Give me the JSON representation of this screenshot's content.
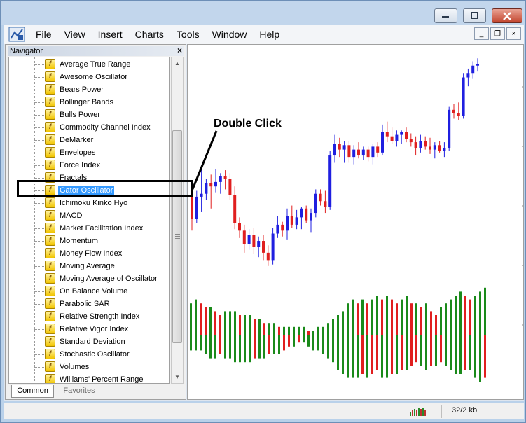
{
  "window": {
    "minimize_icon": "minimize-icon",
    "restore_icon": "restore-icon",
    "close_icon": "close-icon"
  },
  "menu": {
    "items": [
      "File",
      "View",
      "Insert",
      "Charts",
      "Tools",
      "Window",
      "Help"
    ]
  },
  "mdi": {
    "minimize": "_",
    "restore": "❐",
    "close": "×"
  },
  "navigator": {
    "title": "Navigator",
    "close": "×",
    "indicator_icon": "f",
    "items": [
      "Average True Range",
      "Awesome Oscillator",
      "Bears Power",
      "Bollinger Bands",
      "Bulls Power",
      "Commodity Channel Index",
      "DeMarker",
      "Envelopes",
      "Force Index",
      "Fractals",
      "Gator Oscillator",
      "Ichimoku Kinko Hyo",
      "MACD",
      "Market Facilitation Index",
      "Momentum",
      "Money Flow Index",
      "Moving Average",
      "Moving Average of Oscillator",
      "On Balance Volume",
      "Parabolic SAR",
      "Relative Strength Index",
      "Relative Vigor Index",
      "Standard Deviation",
      "Stochastic Oscillator",
      "Volumes",
      "Williams' Percent Range"
    ],
    "selected": "Gator Oscillator",
    "tabs": [
      "Common",
      "Favorites"
    ]
  },
  "annotation": {
    "text": "Double Click"
  },
  "status": {
    "kb": "32/2 kb"
  },
  "colors": {
    "bull": "#1f1fe0",
    "bear": "#e01f1f",
    "gator_up": "#1a8a1a",
    "gator_down": "#e01f1f"
  },
  "candles": [
    {
      "o": 1.312,
      "h": 1.318,
      "l": 1.288,
      "c": 1.296
    },
    {
      "o": 1.296,
      "h": 1.315,
      "l": 1.293,
      "c": 1.311
    },
    {
      "o": 1.311,
      "h": 1.331,
      "l": 1.301,
      "c": 1.313
    },
    {
      "o": 1.313,
      "h": 1.323,
      "l": 1.309,
      "c": 1.32
    },
    {
      "o": 1.32,
      "h": 1.326,
      "l": 1.303,
      "c": 1.318
    },
    {
      "o": 1.318,
      "h": 1.33,
      "l": 1.314,
      "c": 1.321
    },
    {
      "o": 1.321,
      "h": 1.327,
      "l": 1.313,
      "c": 1.325
    },
    {
      "o": 1.325,
      "h": 1.329,
      "l": 1.316,
      "c": 1.323
    },
    {
      "o": 1.323,
      "h": 1.327,
      "l": 1.309,
      "c": 1.312
    },
    {
      "o": 1.312,
      "h": 1.318,
      "l": 1.289,
      "c": 1.293
    },
    {
      "o": 1.293,
      "h": 1.297,
      "l": 1.283,
      "c": 1.288
    },
    {
      "o": 1.288,
      "h": 1.292,
      "l": 1.273,
      "c": 1.279
    },
    {
      "o": 1.279,
      "h": 1.289,
      "l": 1.275,
      "c": 1.285
    },
    {
      "o": 1.285,
      "h": 1.29,
      "l": 1.272,
      "c": 1.277
    },
    {
      "o": 1.277,
      "h": 1.284,
      "l": 1.27,
      "c": 1.281
    },
    {
      "o": 1.281,
      "h": 1.285,
      "l": 1.268,
      "c": 1.273
    },
    {
      "o": 1.273,
      "h": 1.278,
      "l": 1.264,
      "c": 1.268
    },
    {
      "o": 1.268,
      "h": 1.29,
      "l": 1.265,
      "c": 1.286
    },
    {
      "o": 1.286,
      "h": 1.298,
      "l": 1.283,
      "c": 1.292
    },
    {
      "o": 1.292,
      "h": 1.294,
      "l": 1.284,
      "c": 1.288
    },
    {
      "o": 1.288,
      "h": 1.303,
      "l": 1.282,
      "c": 1.298
    },
    {
      "o": 1.298,
      "h": 1.305,
      "l": 1.29,
      "c": 1.292
    },
    {
      "o": 1.292,
      "h": 1.302,
      "l": 1.289,
      "c": 1.297
    },
    {
      "o": 1.297,
      "h": 1.304,
      "l": 1.289,
      "c": 1.303
    },
    {
      "o": 1.303,
      "h": 1.305,
      "l": 1.293,
      "c": 1.295
    },
    {
      "o": 1.295,
      "h": 1.303,
      "l": 1.287,
      "c": 1.3
    },
    {
      "o": 1.3,
      "h": 1.316,
      "l": 1.297,
      "c": 1.313
    },
    {
      "o": 1.313,
      "h": 1.316,
      "l": 1.305,
      "c": 1.308
    },
    {
      "o": 1.308,
      "h": 1.315,
      "l": 1.3,
      "c": 1.304
    },
    {
      "o": 1.304,
      "h": 1.342,
      "l": 1.302,
      "c": 1.339
    },
    {
      "o": 1.339,
      "h": 1.353,
      "l": 1.334,
      "c": 1.347
    },
    {
      "o": 1.347,
      "h": 1.351,
      "l": 1.338,
      "c": 1.343
    },
    {
      "o": 1.343,
      "h": 1.349,
      "l": 1.334,
      "c": 1.346
    },
    {
      "o": 1.346,
      "h": 1.349,
      "l": 1.334,
      "c": 1.338
    },
    {
      "o": 1.338,
      "h": 1.346,
      "l": 1.333,
      "c": 1.343
    },
    {
      "o": 1.343,
      "h": 1.348,
      "l": 1.337,
      "c": 1.339
    },
    {
      "o": 1.339,
      "h": 1.345,
      "l": 1.336,
      "c": 1.343
    },
    {
      "o": 1.343,
      "h": 1.345,
      "l": 1.335,
      "c": 1.338
    },
    {
      "o": 1.338,
      "h": 1.347,
      "l": 1.333,
      "c": 1.345
    },
    {
      "o": 1.345,
      "h": 1.348,
      "l": 1.338,
      "c": 1.341
    },
    {
      "o": 1.341,
      "h": 1.36,
      "l": 1.339,
      "c": 1.355
    },
    {
      "o": 1.355,
      "h": 1.362,
      "l": 1.348,
      "c": 1.352
    },
    {
      "o": 1.352,
      "h": 1.358,
      "l": 1.347,
      "c": 1.349
    },
    {
      "o": 1.349,
      "h": 1.356,
      "l": 1.345,
      "c": 1.353
    },
    {
      "o": 1.353,
      "h": 1.356,
      "l": 1.347,
      "c": 1.355
    },
    {
      "o": 1.355,
      "h": 1.358,
      "l": 1.348,
      "c": 1.35
    },
    {
      "o": 1.35,
      "h": 1.354,
      "l": 1.345,
      "c": 1.348
    },
    {
      "o": 1.348,
      "h": 1.352,
      "l": 1.339,
      "c": 1.344
    },
    {
      "o": 1.344,
      "h": 1.353,
      "l": 1.341,
      "c": 1.349
    },
    {
      "o": 1.349,
      "h": 1.352,
      "l": 1.343,
      "c": 1.345
    },
    {
      "o": 1.345,
      "h": 1.351,
      "l": 1.34,
      "c": 1.343
    },
    {
      "o": 1.343,
      "h": 1.348,
      "l": 1.337,
      "c": 1.346
    },
    {
      "o": 1.346,
      "h": 1.349,
      "l": 1.341,
      "c": 1.342
    },
    {
      "o": 1.342,
      "h": 1.348,
      "l": 1.338,
      "c": 1.344
    },
    {
      "o": 1.344,
      "h": 1.372,
      "l": 1.342,
      "c": 1.37
    },
    {
      "o": 1.37,
      "h": 1.374,
      "l": 1.364,
      "c": 1.368
    },
    {
      "o": 1.368,
      "h": 1.375,
      "l": 1.363,
      "c": 1.366
    },
    {
      "o": 1.366,
      "h": 1.395,
      "l": 1.364,
      "c": 1.392
    },
    {
      "o": 1.392,
      "h": 1.398,
      "l": 1.386,
      "c": 1.395
    },
    {
      "o": 1.395,
      "h": 1.403,
      "l": 1.391,
      "c": 1.4
    },
    {
      "o": 1.4,
      "h": 1.405,
      "l": 1.396,
      "c": 1.401
    }
  ],
  "gator": {
    "upper": [
      8,
      9,
      8,
      7,
      7,
      6,
      5,
      6,
      6,
      6,
      5,
      5,
      5,
      4,
      4,
      3,
      3,
      3,
      2,
      2,
      2,
      2,
      2,
      2,
      1,
      1,
      2,
      2,
      3,
      4,
      5,
      6,
      8,
      9,
      8,
      9,
      8,
      9,
      10,
      9,
      10,
      9,
      8,
      9,
      10,
      8,
      8,
      7,
      8,
      6,
      5,
      7,
      8,
      9,
      10,
      11,
      10,
      9,
      10,
      11,
      12
    ],
    "lower": [
      4,
      4,
      4,
      5,
      6,
      6,
      5,
      6,
      6,
      7,
      7,
      7,
      7,
      6,
      6,
      6,
      5,
      5,
      5,
      4,
      3,
      3,
      2,
      2,
      3,
      4,
      4,
      5,
      6,
      7,
      9,
      10,
      11,
      11,
      11,
      10,
      11,
      10,
      9,
      11,
      11,
      10,
      10,
      9,
      9,
      8,
      7,
      8,
      9,
      8,
      8,
      7,
      8,
      9,
      10,
      10,
      9,
      9,
      11,
      12,
      11
    ]
  }
}
